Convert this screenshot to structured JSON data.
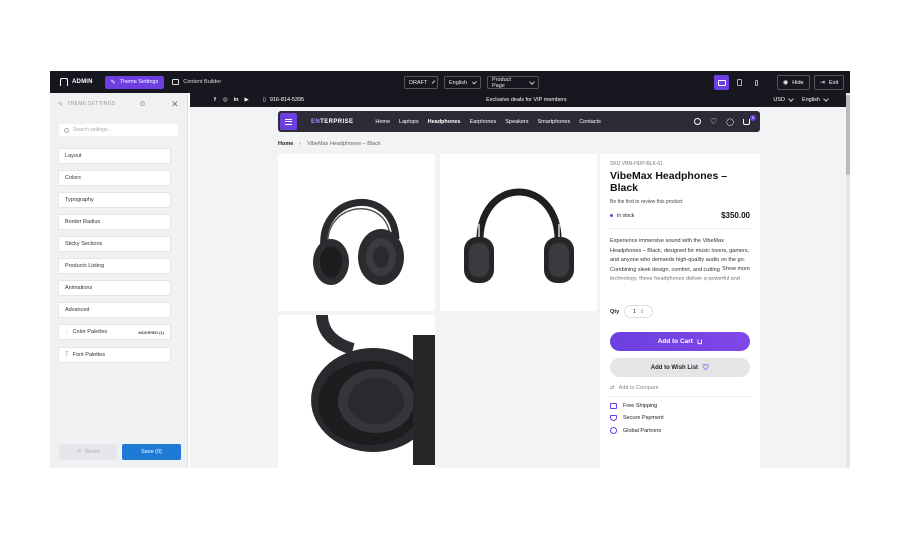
{
  "admin_bar": {
    "brand": "ADMIN",
    "theme_settings_tab": "Theme Settings",
    "content_builder_tab": "Content Builder",
    "status_select": "DRAFT",
    "language_select": "English",
    "page_select": "Product Page",
    "hide_label": "Hide",
    "exit_label": "Exit"
  },
  "panel": {
    "title": "THEME SETTINGS",
    "search_placeholder": "Search settings...",
    "items": [
      "Layout",
      "Colors",
      "Typography",
      "Border Radius",
      "Sticky Sections",
      "Products Listing",
      "Animations",
      "Advanced"
    ],
    "color_palettes": "Color Palettes",
    "color_palettes_badge": "MODIFIED (1)",
    "font_palettes": "Font Palettes",
    "reset_label": "Reset",
    "save_label": "Save (0)"
  },
  "store": {
    "phone": "916-814-5395",
    "promo": "Exclusive deals for VIP members",
    "currency": "USD",
    "language": "English",
    "logo_accent": "EN",
    "logo_rest": "TERPRISE",
    "nav": [
      "Home",
      "Laptops",
      "Headphones",
      "Earphones",
      "Speakers",
      "Smartphones",
      "Contacts"
    ],
    "cart_count": "0",
    "breadcrumb": {
      "home": "Home",
      "current": "VibeMax Headphones – Black"
    }
  },
  "product": {
    "sku": "SKU VBM-HDP-BLK-01",
    "title": "VibeMax Headphones – Black",
    "review_text": "Be the first to review this product",
    "stock": "In stock",
    "price": "$350.00",
    "description": "Experience immersive sound with the VibeMax Headphones – Black, designed for music lovers, gamers, and anyone who demands high-quality audio on the go. Combining sleek design, comfort, and cutting-edge audio technology, these headphones deliver a powerful and balanced",
    "show_more": "Show more",
    "qty_label": "Qty",
    "qty_value": "1",
    "add_to_cart": "Add to Cart",
    "add_to_wishlist": "Add to Wish List",
    "add_to_compare": "Add to Compare",
    "features": [
      "Free Shipping",
      "Secure Payment",
      "Global Partners"
    ]
  },
  "colors": {
    "accent": "#6d3fe0",
    "dark": "#16171f",
    "save": "#1f7ad6"
  }
}
